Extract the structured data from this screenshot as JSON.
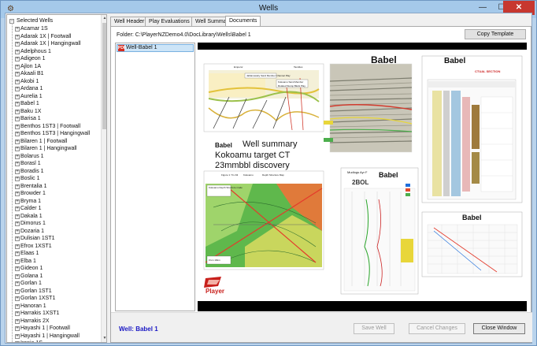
{
  "window": {
    "title": "Wells",
    "minimize_glyph": "—",
    "maximize_glyph": "☐",
    "close_glyph": "✕"
  },
  "tree": {
    "root_label": "Selected Wells",
    "expander_collapsed": "+",
    "expander_expanded": "−",
    "items": [
      "Acamar 1S",
      "Adarak 1X  |  Footwall",
      "Adarak 1X  |  Hangingwall",
      "Adelphous 1",
      "Adigeon 1",
      "Ajlon 1A",
      "Akaali B1",
      "Akobi 1",
      "Ardana 1",
      "Aurelia 1",
      "Babel 1",
      "Baku 1X",
      "Barisa 1",
      "Benthos 1ST3  |  Footwall",
      "Benthos 1ST3  |  Hangingwall",
      "Bilaren 1  |  Footwall",
      "Bilaren 1  |  Hangingwall",
      "Bolarus 1",
      "Borasl 1",
      "Boradis 1",
      "Boslic 1",
      "Brentalia 1",
      "Browder 1",
      "Bryma 1",
      "Calder 1",
      "Dakala 1",
      "Dimorus 1",
      "Dozaria 1",
      "Dulisian 1ST1",
      "Efrox 1XST1",
      "Elaas 1",
      "Elba 1",
      "Gideon 1",
      "Golana 1",
      "Gorlan 1",
      "Gorlan 1ST1",
      "Gorlan 1XST1",
      "Hanoran 1",
      "Harrakis 1XST1",
      "Harrakis 2X",
      "Hayashi 1  |  Footwall",
      "Hayashi 1  |  Hangingwall",
      "Irenia 1S"
    ]
  },
  "tabs": [
    {
      "label": "Well Header"
    },
    {
      "label": "Play Evaluations"
    },
    {
      "label": "Well Summary"
    },
    {
      "label": "Documents"
    }
  ],
  "documents": {
    "folder_text": "Folder:  C:\\PlayerNZDemo4.0\\DocLibrary\\Wells\\Babel 1",
    "copy_button": "Copy Template",
    "list": [
      {
        "label": "Well-Babel 1",
        "icon": "pdf-icon",
        "icon_text": "PDF"
      }
    ]
  },
  "collage": {
    "map_label_left": "Emperor",
    "map_label_right": "Taurides",
    "map_callout_1": "Jablanowsky Sand Member Channel Play",
    "map_callout_2": "Kokoamu Sand Member",
    "map_callout_3": "Rotated Stump Block Play",
    "babel_1": "Babel",
    "babel_2": "Babel",
    "babel_3": "Babel",
    "babel_4": "Babel",
    "babel_5": "Babel",
    "summary_line_1": "Well summary",
    "summary_line_2": "Kokoamu target CT",
    "summary_line_3": "23mmbbl discovery",
    "section_title": "CTUAL SECTION",
    "log_title": "Mudlogs Ayr F",
    "log_code": "2BOL",
    "map2_title_1": "Figure 1: Tm-Mi",
    "map2_title_2": "Kokoamu",
    "map2_title_3": "Depth Structure Map",
    "map2_label": "Kokoamu Depth Structure mode",
    "map2_scale": "0 km 10km",
    "brand": "Player"
  },
  "status": {
    "well_name": "Well: Babel 1",
    "save_button": "Save Well",
    "cancel_button": "Cancel Changes",
    "close_button": "Close Window"
  },
  "colors": {
    "selection": "#cce4f7",
    "well_name": "#1a18c4",
    "close_red": "#c7372f"
  }
}
